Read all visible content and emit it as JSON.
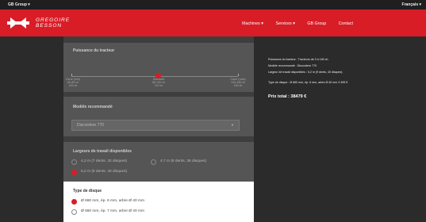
{
  "topbar": {
    "group": "GB Group ▾",
    "language": "Français ▾"
  },
  "brand": {
    "line1": "GREGOIRE",
    "line2": "BESSON"
  },
  "nav": [
    "Machines ▾",
    "Services ▾",
    "GB Group",
    "Contact"
  ],
  "power": {
    "title": "Puissance du tracteur",
    "ticks": [
      {
        "label": "Carré (min)",
        "sub": "60-85 ch",
        "val": "100 ch"
      },
      {
        "label": "Standard",
        "sub": "85-130 ch",
        "val": "110 ch"
      },
      {
        "label": "Carré (max)",
        "sub": "130-160 ch",
        "val": "160 ch"
      }
    ]
  },
  "model": {
    "title": "Modèle recommandé",
    "value": "Discordere 770"
  },
  "widths": {
    "title": "Largeurs de travail disponibles",
    "options": [
      "4,2 m (7 dents, 32 disques)",
      "4,7 m (8 dents, 36 disques)",
      "5,2 m (9 dents, 40 disques)"
    ]
  },
  "discs": {
    "title": "Type de disque",
    "options": [
      "Ø 660 mm, ép. 6 mm, arbre Ø 40 mm",
      "Ø 660 mm, ép. 7 mm, arbre Ø 40 mm"
    ]
  },
  "summary": {
    "items": [
      "Puissance du tracteur : Tracteurs de 0 à 160 ch",
      "Modèle recommandé : Discordere 770",
      "Largeur de travail disponibles : 5,2 m (9 dents, 40 disques)",
      "Type de disque : Ø 660 mm, ép. 6 mm, arbre Ø 40 mm 3 495 €"
    ],
    "total": "Prix total : 38479 €"
  },
  "colors": {
    "accent": "#d81d27"
  }
}
